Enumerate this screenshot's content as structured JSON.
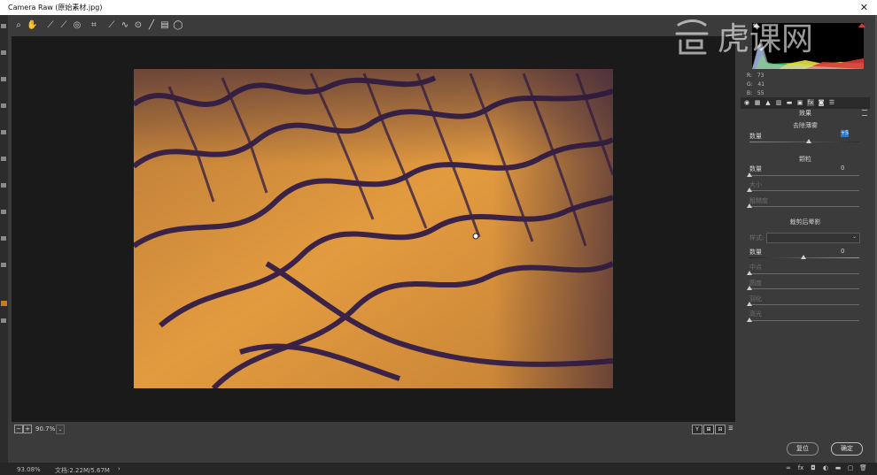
{
  "window": {
    "title": "Camera Raw (原始素材.jpg)",
    "close_label": "✕"
  },
  "toolbar": {
    "tools": [
      {
        "name": "zoom-tool-icon",
        "glyph": "🔍"
      },
      {
        "name": "hand-tool-icon",
        "glyph": "✋"
      },
      {
        "name": "white-balance-tool-icon",
        "glyph": "⟋"
      },
      {
        "name": "color-sampler-icon",
        "glyph": "⟋"
      },
      {
        "name": "targeted-adjustment-icon",
        "glyph": "◎"
      },
      {
        "name": "crop-tool-icon",
        "glyph": "⌗"
      },
      {
        "name": "straighten-tool-icon",
        "glyph": "⟋"
      },
      {
        "name": "spot-removal-icon",
        "glyph": "∿"
      },
      {
        "name": "red-eye-icon",
        "glyph": "⊙"
      },
      {
        "name": "adjustment-brush-icon",
        "glyph": "╱"
      },
      {
        "name": "graduated-filter-icon",
        "glyph": "▤"
      },
      {
        "name": "radial-filter-icon",
        "glyph": "◯"
      }
    ]
  },
  "status": {
    "zoom_out": "−",
    "zoom_in": "+",
    "zoom_value": "90.7%",
    "zoom_dropdown": "⌄",
    "view_buttons": [
      "Y",
      "⊞",
      "⊟",
      "☰"
    ]
  },
  "histogram": {
    "r_label": "R:",
    "r": "73",
    "g_label": "G:",
    "g": "41",
    "b_label": "B:",
    "b": "55"
  },
  "panel": {
    "tab_icons": [
      "basic-tab-icon",
      "tone-curve-tab-icon",
      "detail-tab-icon",
      "hsl-tab-icon",
      "split-toning-tab-icon",
      "lens-tab-icon",
      "effects-tab-icon",
      "camera-calibration-tab-icon",
      "presets-tab-icon"
    ],
    "title": "效果",
    "dehaze": {
      "section": "去除薄雾",
      "amount_label": "数量",
      "amount_value": "+5"
    },
    "grain": {
      "section": "颗粒",
      "amount_label": "数量",
      "amount_value": "0",
      "size_label": "大小",
      "roughness_label": "粗糙度"
    },
    "vignette": {
      "section": "裁剪后晕影",
      "style_label": "样式:",
      "style_value": "",
      "amount_label": "数量",
      "amount_value": "0",
      "midpoint_label": "中点",
      "roundness_label": "圆度",
      "feather_label": "羽化",
      "highlights_label": "高光"
    }
  },
  "buttons": {
    "reset": "复位",
    "ok": "确定"
  },
  "ps_status": {
    "zoom": "93.08%",
    "doc": "文档:2.22M/5.67M",
    "arrow": "›"
  },
  "watermark": {
    "text": "虎课网"
  },
  "colors": {
    "accent": "#2f78c4",
    "photo_orange": "#e39b3f",
    "photo_shadow": "#3a2347"
  }
}
